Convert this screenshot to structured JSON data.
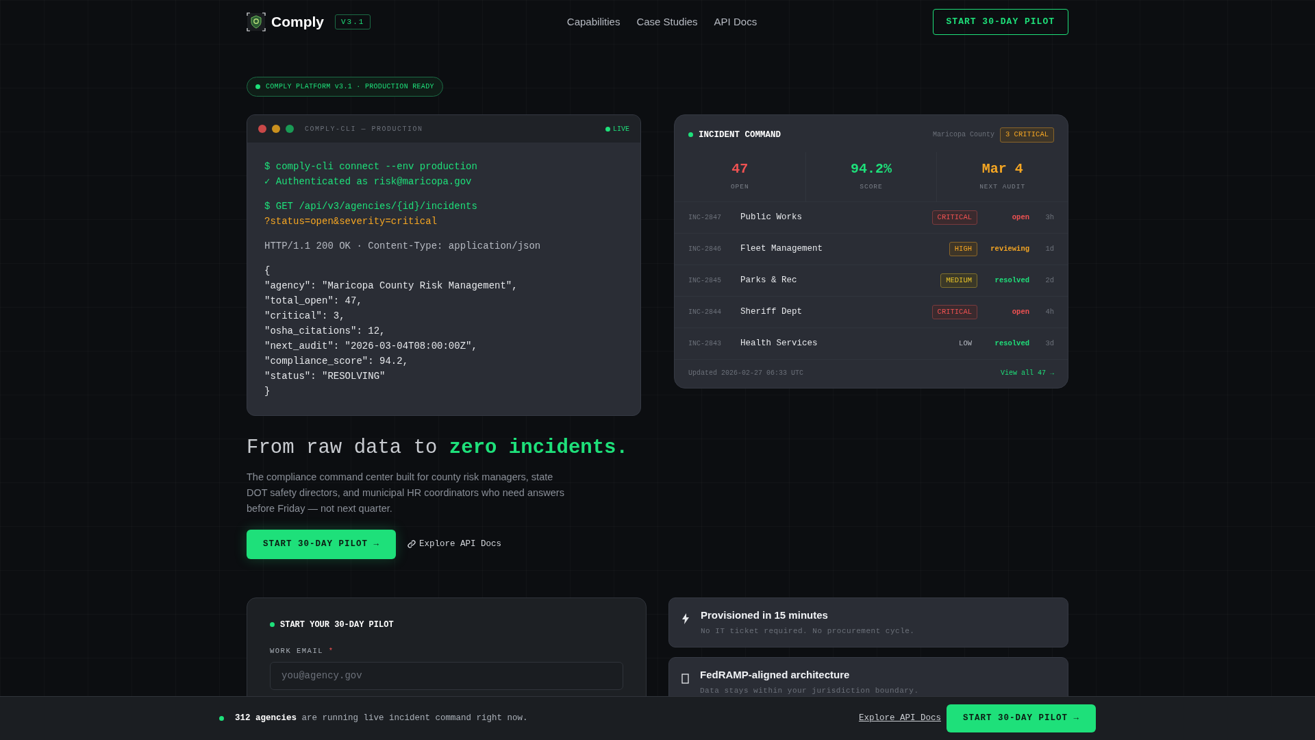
{
  "nav": {
    "brand": "Comply",
    "version": "V3.1",
    "links": [
      "Capabilities",
      "Case Studies",
      "API Docs"
    ],
    "cta": "START 30-DAY PILOT"
  },
  "status_pill": "COMPLY PLATFORM v3.1 · PRODUCTION READY",
  "terminal": {
    "title": "COMPLY-CLI — PRODUCTION",
    "live": "LIVE",
    "blocks": [
      [
        {
          "kind": "command",
          "text": "$ comply-cli connect --env production"
        },
        {
          "kind": "success",
          "text": "✓ Authenticated as risk@maricopa.gov"
        }
      ],
      [
        {
          "kind": "command",
          "text": "$ GET /api/v3/agencies/{id}/incidents"
        },
        {
          "kind": "query",
          "text": "?status=open&severity=critical"
        }
      ],
      [
        {
          "kind": "info",
          "text": "HTTP/1.1 200 OK · Content-Type: application/json"
        }
      ],
      [
        {
          "kind": "json",
          "text": "{"
        },
        {
          "kind": "json",
          "text": "\"agency\": \"Maricopa County Risk Management\","
        },
        {
          "kind": "json",
          "text": "\"total_open\": 47,"
        },
        {
          "kind": "json",
          "text": "\"critical\": 3,"
        },
        {
          "kind": "json",
          "text": "\"osha_citations\": 12,"
        },
        {
          "kind": "json",
          "text": "\"next_audit\": \"2026-03-04T08:00:00Z\","
        },
        {
          "kind": "json",
          "text": "\"compliance_score\": 94.2,"
        },
        {
          "kind": "json",
          "text": "\"status\": \"RESOLVING\""
        },
        {
          "kind": "json",
          "text": "}"
        }
      ]
    ]
  },
  "incident_panel": {
    "title": "INCIDENT COMMAND",
    "county": "Maricopa County",
    "critical_badge": "3 CRITICAL",
    "stats": [
      {
        "value": "47",
        "label": "OPEN",
        "color": "#f05252"
      },
      {
        "value": "94.2%",
        "label": "SCORE",
        "color": "#1ee07a"
      },
      {
        "value": "Mar 4",
        "label": "NEXT AUDIT",
        "color": "#f5a623"
      }
    ],
    "rows": [
      {
        "id": "INC-2847",
        "name": "Public Works",
        "severity": {
          "text": "CRITICAL",
          "kind": "critical"
        },
        "status": {
          "text": "open",
          "kind": "open"
        },
        "age": "3h"
      },
      {
        "id": "INC-2846",
        "name": "Fleet Management",
        "severity": {
          "text": "HIGH",
          "kind": "high"
        },
        "status": {
          "text": "reviewing",
          "kind": "reviewing"
        },
        "age": "1d"
      },
      {
        "id": "INC-2845",
        "name": "Parks & Rec",
        "severity": {
          "text": "MEDIUM",
          "kind": "medium"
        },
        "status": {
          "text": "resolved",
          "kind": "resolved"
        },
        "age": "2d"
      },
      {
        "id": "INC-2844",
        "name": "Sheriff Dept",
        "severity": {
          "text": "CRITICAL",
          "kind": "critical"
        },
        "status": {
          "text": "open",
          "kind": "open"
        },
        "age": "4h"
      },
      {
        "id": "INC-2843",
        "name": "Health Services",
        "severity": {
          "text": "LOW",
          "kind": "low"
        },
        "status": {
          "text": "resolved",
          "kind": "resolved"
        },
        "age": "3d"
      }
    ],
    "updated": "Updated 2026-02-27 06:33 UTC",
    "view_all": "View all 47 →"
  },
  "hero": {
    "heading": "From raw data to **zero incidents.**",
    "body": "The compliance command center built for county risk managers, state DOT safety directors, and municipal HR coordinators who need answers before Friday — not next quarter.",
    "cta": "START 30-DAY PILOT →",
    "secondary": "Explore API Docs"
  },
  "pilot_form": {
    "title": "START YOUR 30-DAY PILOT",
    "fields": [
      {
        "label": "WORK EMAIL",
        "required_mark": "*",
        "placeholder": "you@agency.gov"
      }
    ]
  },
  "features": [
    {
      "kind": "bolt",
      "title": "Provisioned in 15 minutes",
      "text": "No IT ticket required. No procurement cycle."
    },
    {
      "kind": "shield",
      "title": "FedRAMP-aligned architecture",
      "text": "Data stays within your jurisdiction boundary."
    }
  ],
  "bottom_bar": {
    "text": "**312 agencies** are running live incident command right now.",
    "link": "Explore API Docs",
    "cta": "START 30-DAY PILOT →"
  }
}
